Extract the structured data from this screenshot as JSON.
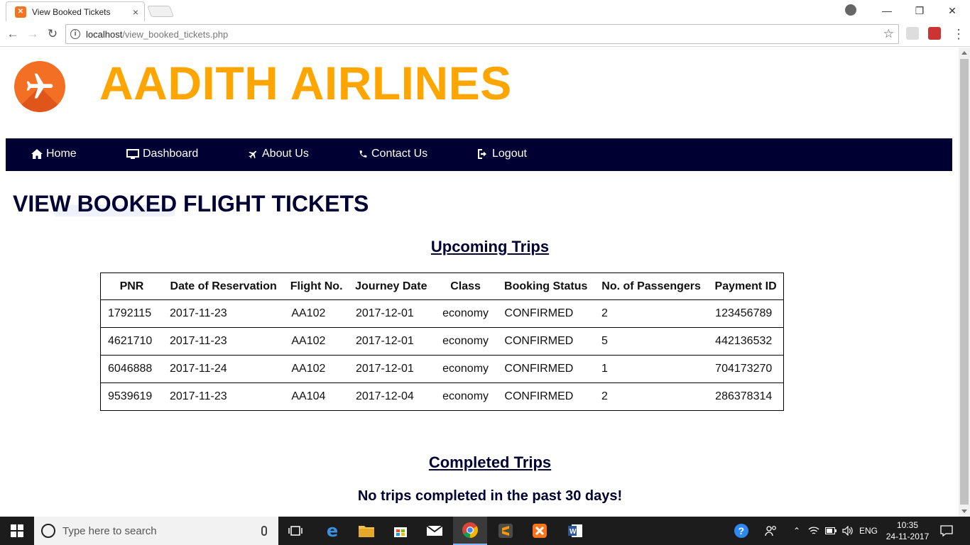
{
  "browser": {
    "tab_title": "View Booked Tickets",
    "tab_close": "×",
    "url_host": "localhost",
    "url_path": "/view_booked_tickets.php"
  },
  "site": {
    "brand": "AADITH AIRLINES",
    "brand_color": "#ffa500",
    "nav_color": "#000033",
    "nav": [
      {
        "label": "Home",
        "icon": "home-icon"
      },
      {
        "label": "Dashboard",
        "icon": "monitor-icon"
      },
      {
        "label": "About Us",
        "icon": "plane-icon"
      },
      {
        "label": "Contact Us",
        "icon": "phone-icon"
      },
      {
        "label": "Logout",
        "icon": "logout-icon"
      }
    ]
  },
  "main": {
    "page_title": "VIEW BOOKED FLIGHT TICKETS",
    "upcoming_title": "Upcoming Trips",
    "completed_title": "Completed Trips",
    "completed_message": "No trips completed in the past 30 days!",
    "table": {
      "headers": [
        "PNR",
        "Date of Reservation",
        "Flight No.",
        "Journey Date",
        "Class",
        "Booking Status",
        "No. of Passengers",
        "Payment ID"
      ],
      "rows": [
        [
          "1792115",
          "2017-11-23",
          "AA102",
          "2017-12-01",
          "economy",
          "CONFIRMED",
          "2",
          "123456789"
        ],
        [
          "4621710",
          "2017-11-23",
          "AA102",
          "2017-12-01",
          "economy",
          "CONFIRMED",
          "5",
          "442136532"
        ],
        [
          "6046888",
          "2017-11-24",
          "AA102",
          "2017-12-01",
          "economy",
          "CONFIRMED",
          "1",
          "704173270"
        ],
        [
          "9539619",
          "2017-11-23",
          "AA104",
          "2017-12-04",
          "economy",
          "CONFIRMED",
          "2",
          "286378314"
        ]
      ]
    }
  },
  "taskbar": {
    "search_placeholder": "Type here to search",
    "language": "ENG",
    "time": "10:35",
    "date": "24-11-2017"
  }
}
